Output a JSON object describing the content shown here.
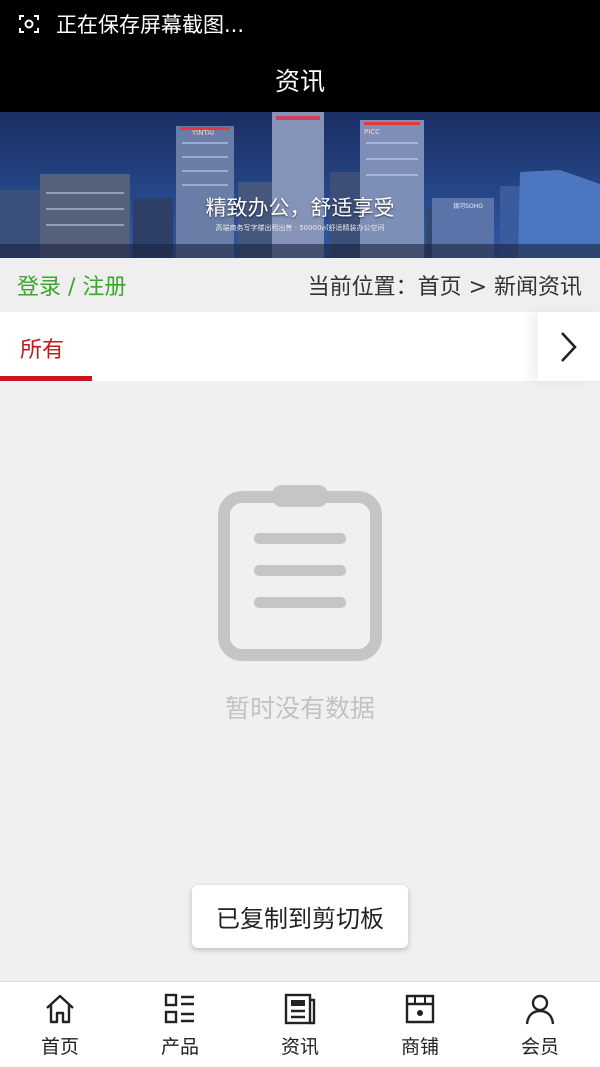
{
  "status_bar": {
    "text": "正在保存屏幕截图...",
    "icon": "screenshot-icon"
  },
  "app_bar": {
    "title": "资讯"
  },
  "banner": {
    "slogan": "精致办公，舒适享受",
    "subline": "高端商务写字楼出租出售 · 50000㎡舒适精装办公空间",
    "sign_yintai": "YINTAI",
    "sign_picc": "PICC",
    "sign_soho": "银河SOHO"
  },
  "location_bar": {
    "login_text": "登录 / 注册",
    "breadcrumb": "当前位置：首页 > 新闻资讯",
    "colors": {
      "login": "#3aa62e"
    }
  },
  "tabs": {
    "items": [
      {
        "label": "所有",
        "active": true
      }
    ],
    "more_icon": "chevron-right-icon",
    "colors": {
      "active": "#c8161d"
    }
  },
  "empty_state": {
    "icon": "clipboard-icon",
    "text": "暂时没有数据"
  },
  "toast": {
    "text": "已复制到剪切板"
  },
  "bottom_nav": {
    "items": [
      {
        "label": "首页",
        "icon": "home-icon"
      },
      {
        "label": "产品",
        "icon": "grid-list-icon"
      },
      {
        "label": "资讯",
        "icon": "news-icon"
      },
      {
        "label": "商铺",
        "icon": "shop-icon"
      },
      {
        "label": "会员",
        "icon": "user-icon"
      }
    ]
  }
}
